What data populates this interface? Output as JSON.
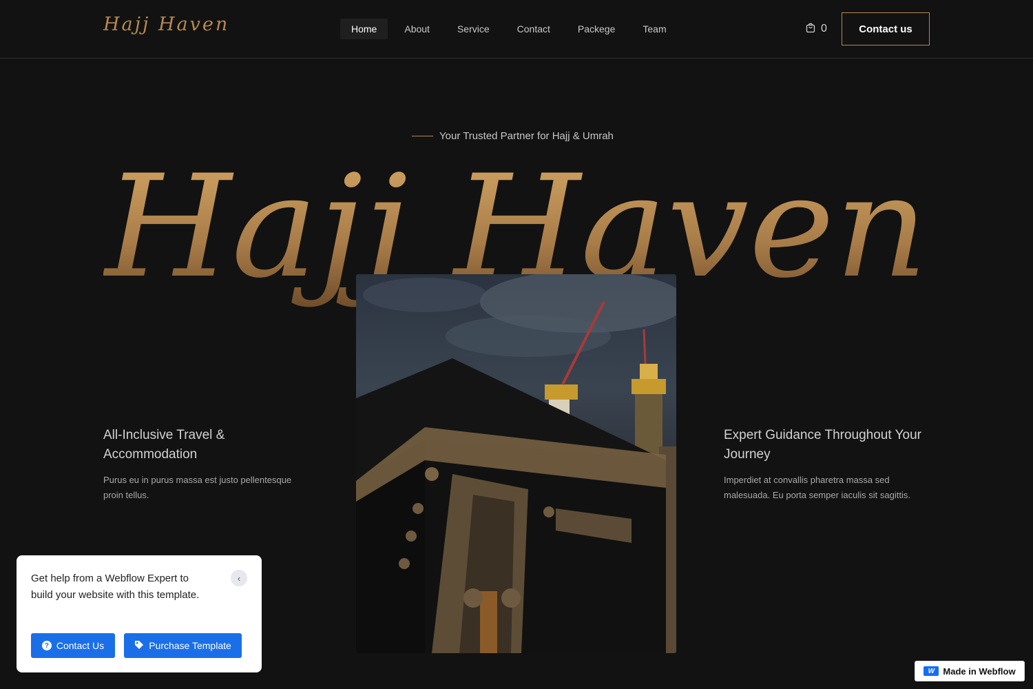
{
  "header": {
    "logo": "Hajj Haven",
    "nav": [
      {
        "label": "Home",
        "active": true
      },
      {
        "label": "About",
        "active": false
      },
      {
        "label": "Service",
        "active": false
      },
      {
        "label": "Contact",
        "active": false
      },
      {
        "label": "Packege",
        "active": false
      },
      {
        "label": "Team",
        "active": false
      }
    ],
    "cart_count": "0",
    "contact_button": "Contact us"
  },
  "hero": {
    "tagline": "Your Trusted Partner for Hajj & Umrah",
    "title": "Hajj Haven",
    "image_subject": "Kaaba at night",
    "features": [
      {
        "title": "All-Inclusive Travel & Accommodation",
        "text": "Purus eu in purus massa est justo pellentesque proin tellus."
      },
      {
        "title": "Expert Guidance Throughout Your Journey",
        "text": "Imperdiet at convallis pharetra massa sed malesuada. Eu porta semper iaculis sit sagittis."
      }
    ]
  },
  "help_widget": {
    "text": "Get help from a Webflow Expert to build your website with this template.",
    "contact_button": "Contact Us",
    "purchase_button": "Purchase Template"
  },
  "badge": {
    "label": "Made in Webflow"
  },
  "colors": {
    "background": "#121212",
    "gold": "#b8894f",
    "blue": "#1a6fe8"
  }
}
